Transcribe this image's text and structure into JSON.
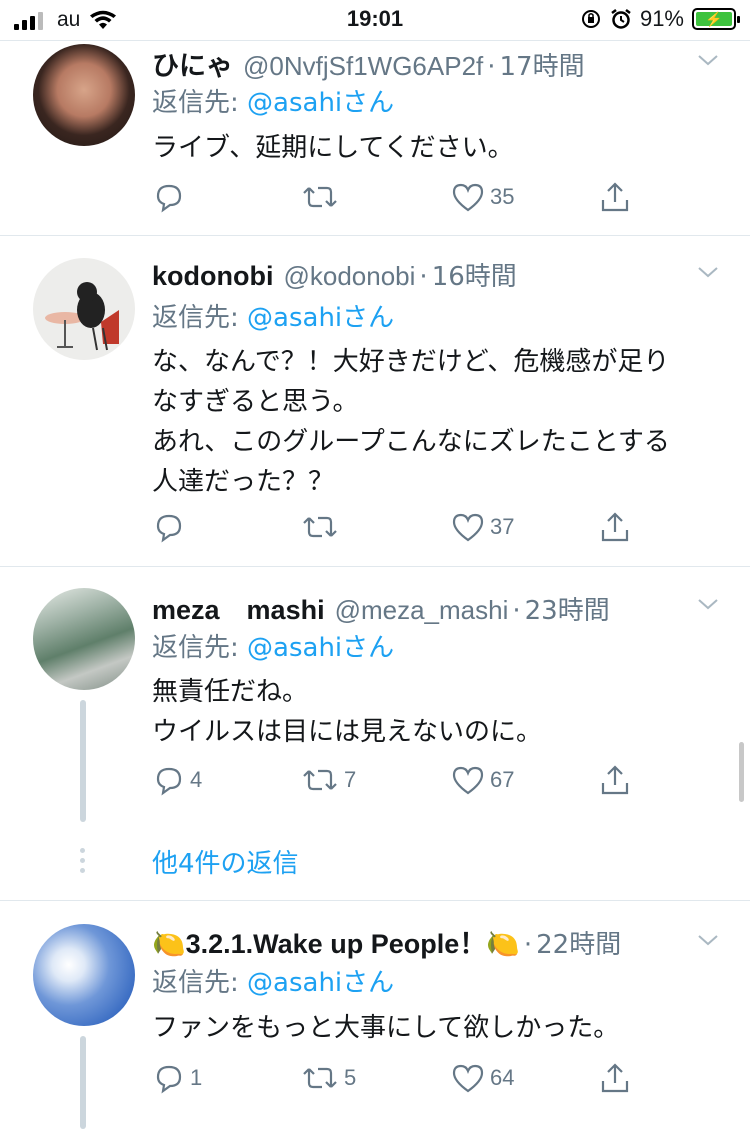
{
  "status_bar": {
    "carrier": "au",
    "time": "19:01",
    "battery": "91%"
  },
  "tweets": [
    {
      "name": "ひにゃ",
      "handle": "@0NvfjSf1WG6AP2f",
      "time": "17時間",
      "reply_label": "返信先:",
      "reply_mention": "@asahiさん",
      "lines": [
        "ライブ、延期にしてください。"
      ],
      "replies": "",
      "retweets": "",
      "likes": "35"
    },
    {
      "name": "kodonobi",
      "handle": "@kodonobi",
      "time": "16時間",
      "reply_label": "返信先:",
      "reply_mention": "@asahiさん",
      "lines": [
        "な、なんで？！大好きだけど、危機感が足り",
        "なすぎると思う。",
        "あれ、このグループこんなにズレたことする",
        "人達だった？？"
      ],
      "replies": "",
      "retweets": "",
      "likes": "37"
    },
    {
      "name": "meza　mashi",
      "handle": "@meza_mashi",
      "time": "23時間",
      "reply_label": "返信先:",
      "reply_mention": "@asahiさん",
      "lines": [
        "無責任だね。",
        "ウイルスは目には見えないのに。"
      ],
      "replies": "4",
      "retweets": "7",
      "likes": "67",
      "more_replies": "他4件の返信"
    },
    {
      "name": "🍋3.2.1.Wake up People！🍋",
      "handle": "",
      "time": "22時間",
      "reply_label": "返信先:",
      "reply_mention": "@asahiさん",
      "lines": [
        "ファンをもっと大事にして欲しかった。"
      ],
      "replies": "1",
      "retweets": "5",
      "likes": "64"
    }
  ],
  "icons": {
    "reply": "reply-icon",
    "retweet": "retweet-icon",
    "like": "heart-icon",
    "share": "share-icon",
    "chevron": "chevron-down-icon"
  },
  "colors": {
    "link": "#1da1f2",
    "muted": "#657786",
    "text": "#14171a",
    "divider": "#e1e8ed"
  }
}
